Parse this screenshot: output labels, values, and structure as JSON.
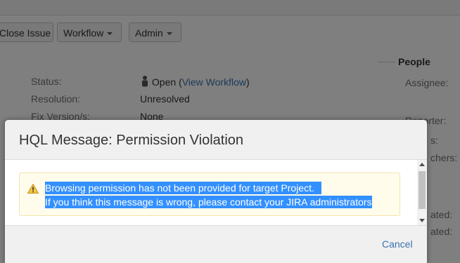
{
  "toolbar": {
    "close_issue": "Close Issue",
    "workflow": "Workflow",
    "admin": "Admin"
  },
  "details": {
    "status_label": "Status:",
    "status_value": "Open",
    "status_paren_open": "(",
    "view_workflow": "View Workflow",
    "status_paren_close": ")",
    "resolution_label": "Resolution:",
    "resolution_value": "Unresolved",
    "fix_versions_label": "Fix Version/s:",
    "fix_versions_value": "None"
  },
  "people": {
    "heading": "People",
    "assignee_label": "Assignee:",
    "reporter_label": "Reporter:",
    "votes_label": "s:",
    "watchers_label": "chers:"
  },
  "dates": {
    "created_label": "ated:",
    "updated_label": "ated:"
  },
  "dialog": {
    "title": "HQL Message: Permission Violation",
    "message_line1": "Browsing permission has not been provided for target Project.",
    "message_line2": "If you think this message is wrong, please contact your JIRA administrators",
    "cancel": "Cancel"
  },
  "icons": {
    "warning": "warning-icon",
    "status": "person-icon",
    "dropdown": "caret-down-icon"
  },
  "colors": {
    "selection": "#3390ff",
    "link": "#3b73af",
    "warning_bg": "#fffcec",
    "warning_icon": "#f6c342"
  }
}
